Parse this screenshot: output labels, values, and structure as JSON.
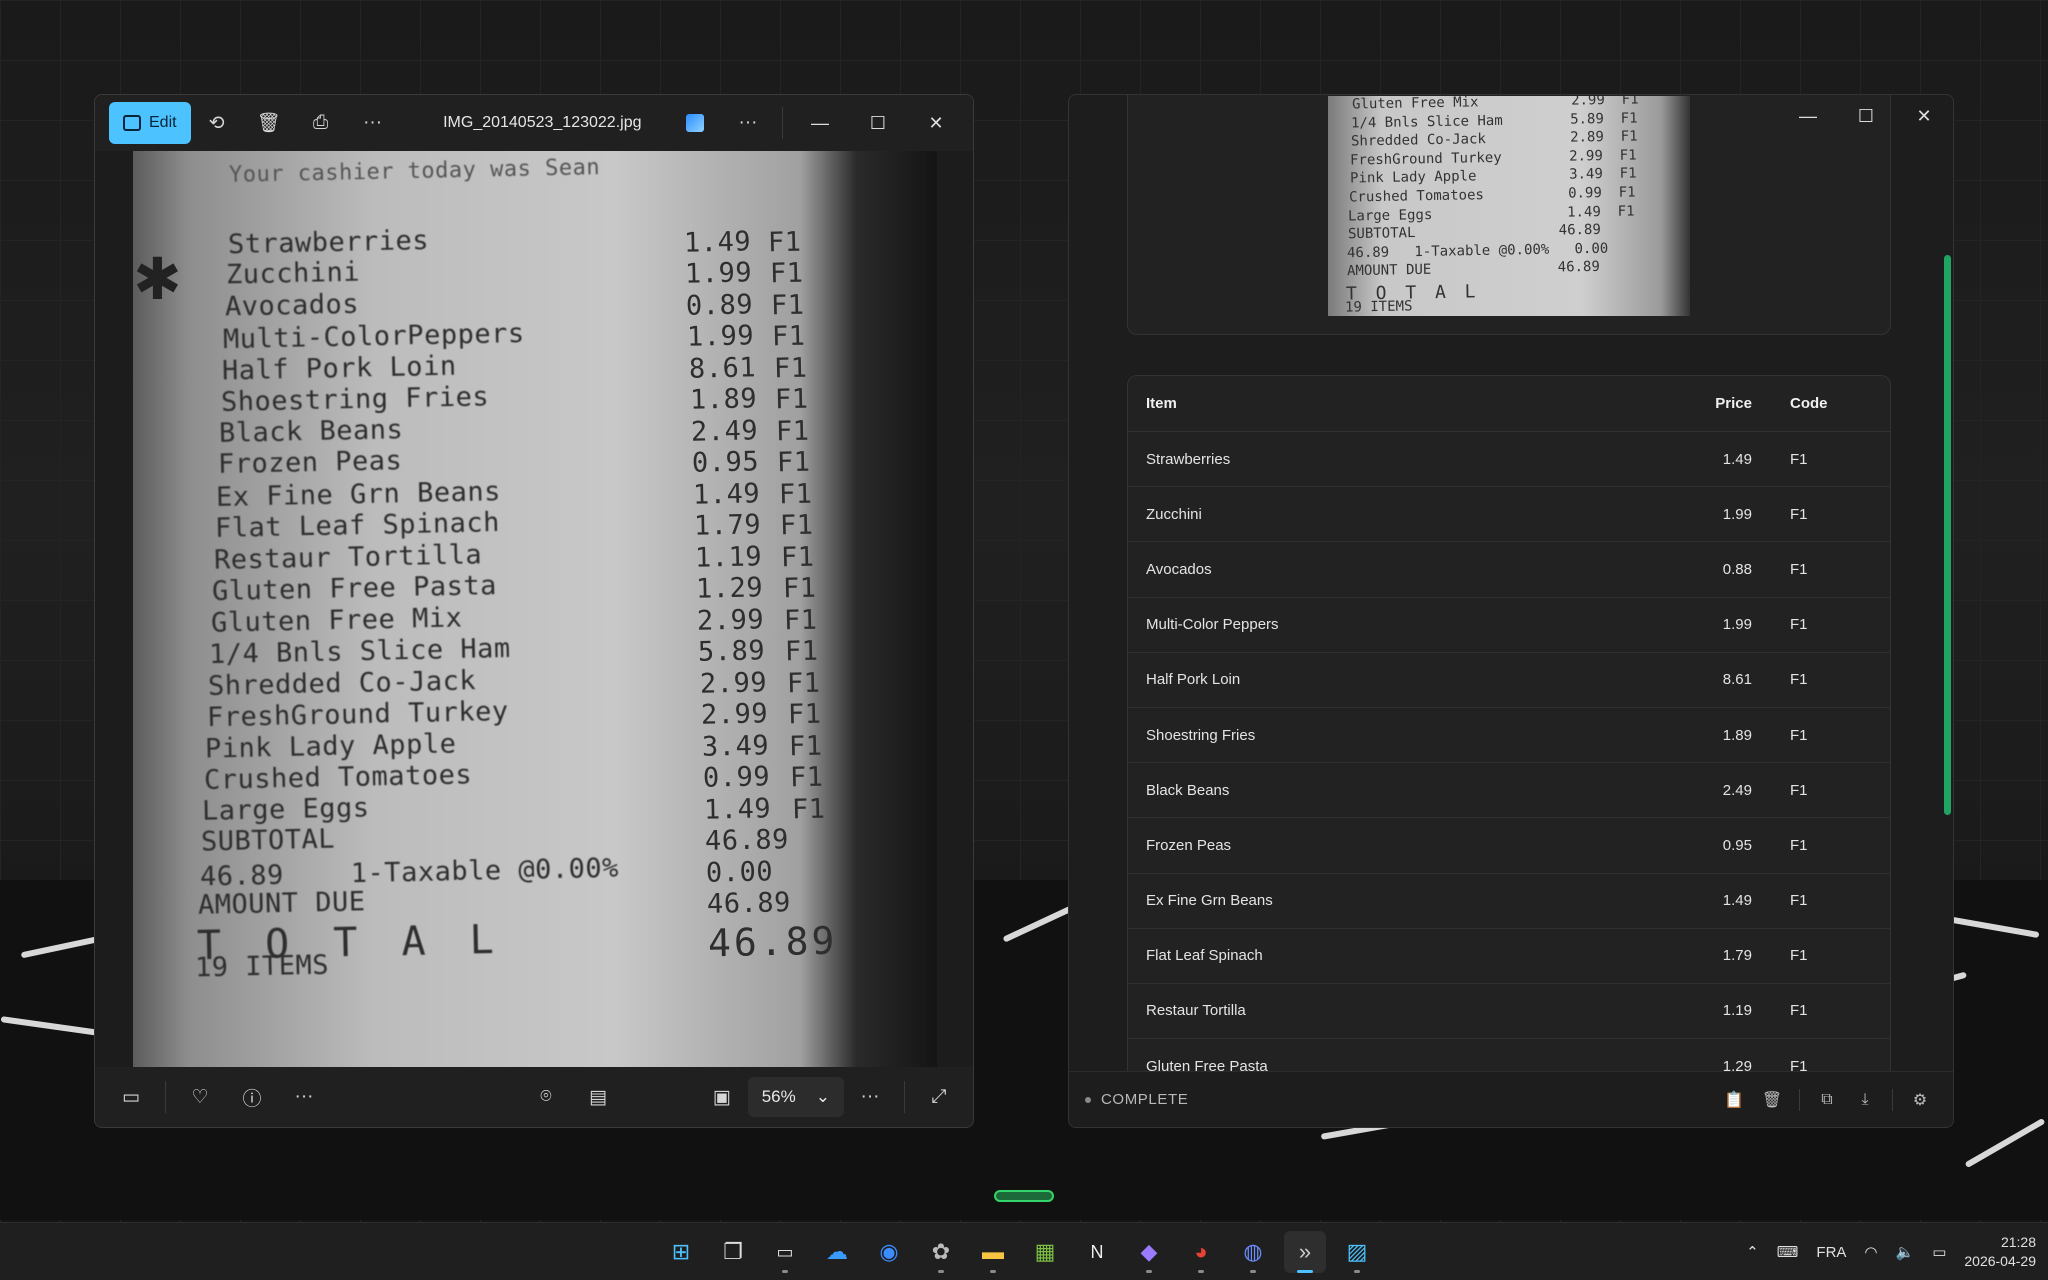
{
  "photos": {
    "edit_label": "Edit",
    "filename": "IMG_20140523_123022.jpg",
    "zoom": "56%",
    "receipt_lines": [
      {
        "name": "Your cashier today was Sean",
        "price": "",
        "code": ""
      },
      {
        "name": "Strawberries",
        "price": "1.49",
        "code": "F1"
      },
      {
        "name": "Zucchini",
        "price": "1.99",
        "code": "F1"
      },
      {
        "name": "Avocados",
        "price": "0.89",
        "code": "F1"
      },
      {
        "name": "Multi-ColorPeppers",
        "price": "1.99",
        "code": "F1"
      },
      {
        "name": "Half Pork Loin",
        "price": "8.61",
        "code": "F1"
      },
      {
        "name": "Shoestring Fries",
        "price": "1.89",
        "code": "F1"
      },
      {
        "name": "Black Beans",
        "price": "2.49",
        "code": "F1"
      },
      {
        "name": "Frozen Peas",
        "price": "0.95",
        "code": "F1"
      },
      {
        "name": "Ex Fine Grn Beans",
        "price": "1.49",
        "code": "F1"
      },
      {
        "name": "Flat Leaf Spinach",
        "price": "1.79",
        "code": "F1"
      },
      {
        "name": "Restaur Tortilla",
        "price": "1.19",
        "code": "F1"
      },
      {
        "name": "Gluten Free Pasta",
        "price": "1.29",
        "code": "F1"
      },
      {
        "name": "Gluten Free Mix",
        "price": "2.99",
        "code": "F1"
      },
      {
        "name": "1/4 Bnls Slice Ham",
        "price": "5.89",
        "code": "F1"
      },
      {
        "name": "Shredded Co-Jack",
        "price": "2.99",
        "code": "F1"
      },
      {
        "name": "FreshGround Turkey",
        "price": "2.99",
        "code": "F1"
      },
      {
        "name": "Pink Lady Apple",
        "price": "3.49",
        "code": "F1"
      },
      {
        "name": "Crushed Tomatoes",
        "price": "0.99",
        "code": "F1"
      },
      {
        "name": "Large Eggs",
        "price": "1.49",
        "code": "F1"
      },
      {
        "name": "SUBTOTAL",
        "price": "46.89",
        "code": ""
      },
      {
        "name": "46.89    1-Taxable @0.00%",
        "price": "0.00",
        "code": ""
      },
      {
        "name": "AMOUNT DUE",
        "price": "46.89",
        "code": ""
      },
      {
        "name": "T O T A L",
        "price": "46.89",
        "code": ""
      },
      {
        "name": "19 ITEMS",
        "price": "",
        "code": ""
      }
    ]
  },
  "ocr": {
    "preview_lines": [
      "Gluten Free Mix           2.99  F1",
      "1/4 Bnls Slice Ham        5.89  F1",
      "Shredded Co-Jack          2.89  F1",
      "FreshGround Turkey        2.99  F1",
      "Pink Lady Apple           3.49  F1",
      "Crushed Tomatoes          0.99  F1",
      "Large Eggs                1.49  F1",
      "SUBTOTAL                 46.89",
      "46.89   1-Taxable @0.00%   0.00",
      "AMOUNT DUE               46.89",
      "T O T A L              46.89",
      "19 ITEMS"
    ],
    "headers": {
      "item": "Item",
      "price": "Price",
      "code": "Code"
    },
    "rows": [
      {
        "item": "Strawberries",
        "price": "1.49",
        "code": "F1"
      },
      {
        "item": "Zucchini",
        "price": "1.99",
        "code": "F1"
      },
      {
        "item": "Avocados",
        "price": "0.88",
        "code": "F1"
      },
      {
        "item": "Multi-Color Peppers",
        "price": "1.99",
        "code": "F1"
      },
      {
        "item": "Half Pork Loin",
        "price": "8.61",
        "code": "F1"
      },
      {
        "item": "Shoestring Fries",
        "price": "1.89",
        "code": "F1"
      },
      {
        "item": "Black Beans",
        "price": "2.49",
        "code": "F1"
      },
      {
        "item": "Frozen Peas",
        "price": "0.95",
        "code": "F1"
      },
      {
        "item": "Ex Fine Grn Beans",
        "price": "1.49",
        "code": "F1"
      },
      {
        "item": "Flat Leaf Spinach",
        "price": "1.79",
        "code": "F1"
      },
      {
        "item": "Restaur Tortilla",
        "price": "1.19",
        "code": "F1"
      },
      {
        "item": "Gluten Free Pasta",
        "price": "1.29",
        "code": "F1"
      }
    ],
    "status": "COMPLETE",
    "colors": {
      "accent": "#1fa463"
    }
  },
  "taskbar": {
    "language": "FRA",
    "time": "21:28",
    "date": "2026-04-29"
  },
  "colors": {
    "edit_accent": "#4cc2ff"
  }
}
